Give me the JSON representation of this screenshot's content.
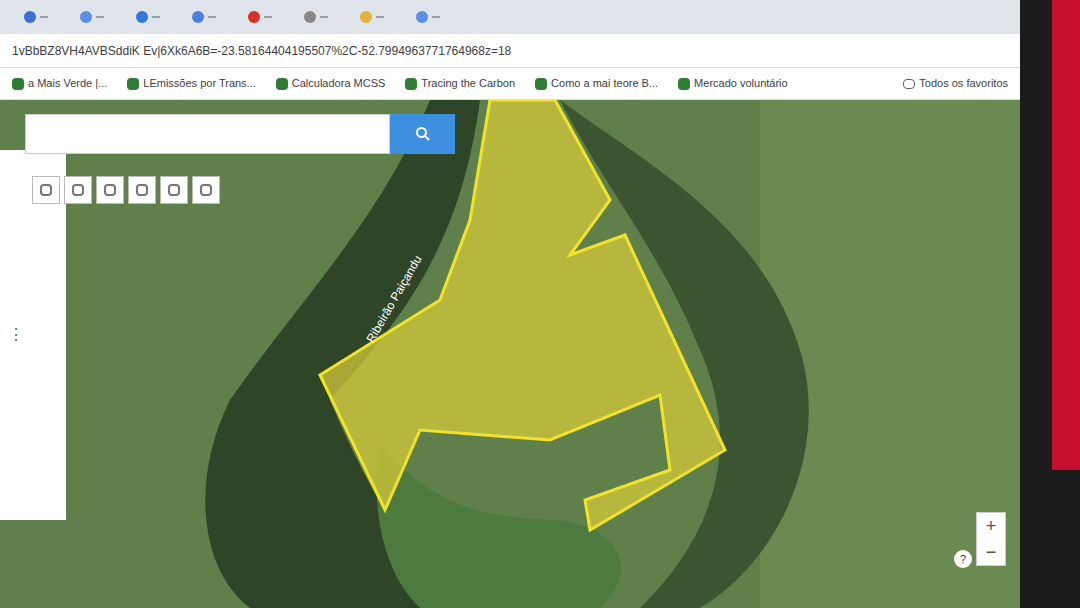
{
  "browser": {
    "url": "1vBbBZ8VH4AVBSddiK Ev|6Xk6A6B=-23.58164404195507%2C-52.7994963771764968z=18",
    "tabs_count": "8",
    "bookmarks": [
      {
        "label": "a Mais Verde |..."
      },
      {
        "label": "LEmissões por Trans..."
      },
      {
        "label": "Calculadora MCSS"
      },
      {
        "label": "Tracing the Carbon"
      },
      {
        "label": "Como a mai teore B..."
      },
      {
        "label": "Mercado voluntário"
      }
    ],
    "all_bookmarks": "Todos os favoritos"
  },
  "map": {
    "search": {
      "placeholder": ""
    },
    "river_label": "Ribeirão Paiçandu",
    "panel_menu": "⋮",
    "zoom_in": "+",
    "zoom_out": "−",
    "help": "?",
    "selected_area_color": "#d4c93a"
  }
}
